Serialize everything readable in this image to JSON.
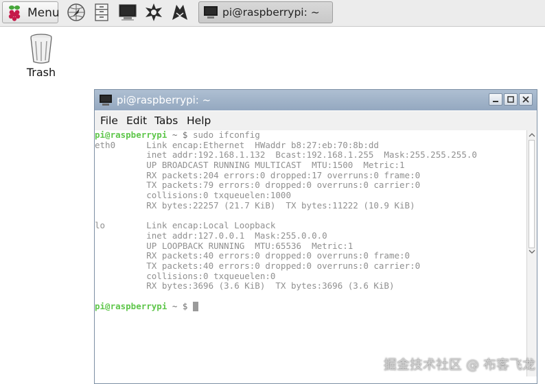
{
  "panel": {
    "menu_label": "Menu",
    "launchers": [
      "browser-icon",
      "file-manager-icon",
      "terminal-icon",
      "wolfram-icon",
      "mathematica-icon"
    ],
    "task": {
      "label": "pi@raspberrypi: ~",
      "icon": "terminal-icon"
    }
  },
  "desktop": {
    "trash_label": "Trash"
  },
  "window": {
    "title": "pi@raspberrypi: ~",
    "menu": [
      "File",
      "Edit",
      "Tabs",
      "Help"
    ],
    "prompt": "pi@raspberrypi",
    "prompt_suffix": " ~ $ ",
    "command": "sudo ifconfig",
    "output": [
      "eth0      Link encap:Ethernet  HWaddr b8:27:eb:70:8b:dd",
      "          inet addr:192.168.1.132  Bcast:192.168.1.255  Mask:255.255.255.0",
      "          UP BROADCAST RUNNING MULTICAST  MTU:1500  Metric:1",
      "          RX packets:204 errors:0 dropped:17 overruns:0 frame:0",
      "          TX packets:79 errors:0 dropped:0 overruns:0 carrier:0",
      "          collisions:0 txqueuelen:1000",
      "          RX bytes:22257 (21.7 KiB)  TX bytes:11222 (10.9 KiB)",
      "",
      "lo        Link encap:Local Loopback",
      "          inet addr:127.0.0.1  Mask:255.0.0.0",
      "          UP LOOPBACK RUNNING  MTU:65536  Metric:1",
      "          RX packets:40 errors:0 dropped:0 overruns:0 frame:0",
      "          TX packets:40 errors:0 dropped:0 overruns:0 carrier:0",
      "          collisions:0 txqueuelen:0",
      "          RX bytes:3696 (3.6 KiB)  TX bytes:3696 (3.6 KiB)",
      ""
    ]
  },
  "watermark": "掘金技术社区 @ 布客飞龙",
  "colors": {
    "prompt": "#5ec64a",
    "titlebar": "#94a8c0",
    "terminal_text": "#8f8f8f"
  }
}
